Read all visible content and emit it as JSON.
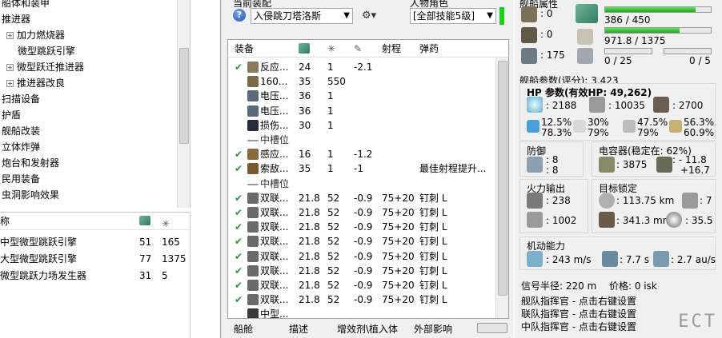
{
  "left_tree": {
    "items": [
      {
        "label": "船体和装甲",
        "indent": 0,
        "expander": false
      },
      {
        "label": "推进器",
        "indent": 0,
        "expander": false
      },
      {
        "label": "加力燃烧器",
        "indent": 1,
        "expander": true
      },
      {
        "label": "微型跳跃引擎",
        "indent": 2,
        "expander": false,
        "selected": true
      },
      {
        "label": "微型跃迁推进器",
        "indent": 1,
        "expander": true
      },
      {
        "label": "推进器改良",
        "indent": 1,
        "expander": true
      },
      {
        "label": "扫描设备",
        "indent": 0,
        "expander": false
      },
      {
        "label": "护盾",
        "indent": 0,
        "expander": false
      },
      {
        "label": "舰船改装",
        "indent": 0,
        "expander": false
      },
      {
        "label": "立体炸弹",
        "indent": 0,
        "expander": false
      },
      {
        "label": "炮台和发射器",
        "indent": 0,
        "expander": false
      },
      {
        "label": "民用装备",
        "indent": 0,
        "expander": false
      },
      {
        "label": "虫洞影响效果",
        "indent": 0,
        "expander": false
      }
    ]
  },
  "left_list": {
    "header_name": "称",
    "rows": [
      {
        "name": "中型微型跳跃引擎",
        "cpu": "51",
        "pg": "165"
      },
      {
        "name": "大型微型跳跃引擎",
        "cpu": "77",
        "pg": "1375"
      },
      {
        "name": "微型跳跃力场发生器",
        "cpu": "31",
        "pg": "5"
      }
    ]
  },
  "fitting": {
    "current_fit_label": "当前装配",
    "current_fit_value": "入侵跳刀塔洛斯",
    "character_label": "人物角色",
    "character_value": "[全部技能5级]",
    "columns": {
      "equip": "装备",
      "range": "射程",
      "ammo": "弹药"
    },
    "rows": [
      {
        "check": true,
        "name": "反应...",
        "cpu": "24",
        "pg": "1",
        "cap": "-2.1",
        "range": "",
        "ammo": "",
        "icon": "#8a7a5a"
      },
      {
        "check": false,
        "name": "160...",
        "cpu": "35",
        "pg": "550",
        "cap": "",
        "range": "",
        "ammo": "",
        "icon": "#7a6a4a"
      },
      {
        "check": false,
        "name": "电压...",
        "cpu": "36",
        "pg": "1",
        "cap": "",
        "range": "",
        "ammo": "",
        "icon": "#5a6a7a"
      },
      {
        "check": false,
        "name": "电压...",
        "cpu": "36",
        "pg": "1",
        "cap": "",
        "range": "",
        "ammo": "",
        "icon": "#5a6a7a"
      },
      {
        "check": false,
        "name": "损伤...",
        "cpu": "30",
        "pg": "1",
        "cap": "",
        "range": "",
        "ammo": "",
        "icon": "#2a2a3a"
      },
      {
        "check": false,
        "name": "中槽位",
        "cpu": "",
        "pg": "",
        "cap": "",
        "range": "",
        "ammo": "",
        "icon": "",
        "slot": true
      },
      {
        "check": true,
        "name": "感应...",
        "cpu": "16",
        "pg": "1",
        "cap": "-1.2",
        "range": "",
        "ammo": "",
        "icon": "#8a6a3a"
      },
      {
        "check": true,
        "name": "索敌...",
        "cpu": "35",
        "pg": "1",
        "cap": "-1",
        "range": "",
        "ammo": "最佳射程提升...",
        "icon": "#7a5a2a"
      },
      {
        "check": false,
        "name": "中槽位",
        "cpu": "",
        "pg": "",
        "cap": "",
        "range": "",
        "ammo": "",
        "icon": "",
        "slot": true
      },
      {
        "check": true,
        "name": "双联...",
        "cpu": "21.8",
        "pg": "52",
        "cap": "-0.9",
        "range": "75+20",
        "ammo": "钉刺 L",
        "icon": "#6a6a6a"
      },
      {
        "check": true,
        "name": "双联...",
        "cpu": "21.8",
        "pg": "52",
        "cap": "-0.9",
        "range": "75+20",
        "ammo": "钉刺 L",
        "icon": "#6a6a6a"
      },
      {
        "check": true,
        "name": "双联...",
        "cpu": "21.8",
        "pg": "52",
        "cap": "-0.9",
        "range": "75+20",
        "ammo": "钉刺 L",
        "icon": "#6a6a6a"
      },
      {
        "check": true,
        "name": "双联...",
        "cpu": "21.8",
        "pg": "52",
        "cap": "-0.9",
        "range": "75+20",
        "ammo": "钉刺 L",
        "icon": "#6a6a6a"
      },
      {
        "check": true,
        "name": "双联...",
        "cpu": "21.8",
        "pg": "52",
        "cap": "-0.9",
        "range": "75+20",
        "ammo": "钉刺 L",
        "icon": "#6a6a6a"
      },
      {
        "check": true,
        "name": "双联...",
        "cpu": "21.8",
        "pg": "52",
        "cap": "-0.9",
        "range": "75+20",
        "ammo": "钉刺 L",
        "icon": "#6a6a6a"
      },
      {
        "check": true,
        "name": "双联...",
        "cpu": "21.8",
        "pg": "52",
        "cap": "-0.9",
        "range": "75+20",
        "ammo": "钉刺 L",
        "icon": "#6a6a6a"
      },
      {
        "check": true,
        "name": "双联...",
        "cpu": "21.8",
        "pg": "52",
        "cap": "-0.9",
        "range": "75+20",
        "ammo": "钉刺 L",
        "icon": "#6a6a6a"
      },
      {
        "check": false,
        "name": "中型...",
        "cpu": "",
        "pg": "",
        "cap": "",
        "range": "",
        "ammo": "",
        "icon": "#3a3a3a"
      }
    ],
    "tabs": [
      "船舱",
      "描述",
      "增效剂\\植入体",
      "外部影响"
    ]
  },
  "stats": {
    "ship_attr_title": "舰船属性",
    "slots": {
      "turret": ": 0",
      "launcher": ": 0",
      "drone_bay": ": 175"
    },
    "cpu": {
      "text": "386 / 450",
      "fill": 0.858
    },
    "pg": {
      "text": "971.8 / 1375",
      "fill": 0.707
    },
    "drone": {
      "left": "0 / 25",
      "right": "0 / 5"
    },
    "params_title": "舰船参数(评分): 3,423",
    "hp_title": "HP 参数(有效HP: 49,262)",
    "hp": {
      "shield": ": 2188",
      "armor": ": 10035",
      "hull": ": 2700"
    },
    "resists": [
      {
        "a": "12.5%",
        "b": "78.3%"
      },
      {
        "a": "30%",
        "b": "79%"
      },
      {
        "a": "47.5%",
        "b": "79%"
      },
      {
        "a": "56.3%",
        "b": "60.9%"
      }
    ],
    "defense_title": "防御",
    "defense": {
      "a": ": 8",
      "b": ": 8"
    },
    "cap_title": "电容器(稳定在: 62%)",
    "cap": {
      "amount": ": 3875",
      "delta_a": ": - 11.8",
      "delta_b": "+16.7"
    },
    "firepower_title": "火力输出",
    "firepower": {
      "a": ": 238",
      "b": ": 1002"
    },
    "targeting_title": "目标锁定",
    "targeting": {
      "range": ": 113.75 km",
      "targets": ": 7",
      "res": ": 341.3 mm",
      "scan": ": 35.5"
    },
    "mobility_title": "机动能力",
    "mobility": {
      "speed": ": 243 m/s",
      "align": ": 7.7 s",
      "warp": ": 2.7 au/s"
    },
    "signature": "信号半径: 220 m",
    "price": "价格: 0 isk",
    "fleet_boost_1": "舰队指挥官 - 点击右键设置",
    "fleet_boost_2": "联队指挥官 - 点击右键设置",
    "fleet_boost_3": "中队指挥官 - 点击右键设置",
    "logo": "ECT"
  },
  "colors": {
    "accent_green": "#1aa81a",
    "check_green": "#2a9a2a"
  }
}
